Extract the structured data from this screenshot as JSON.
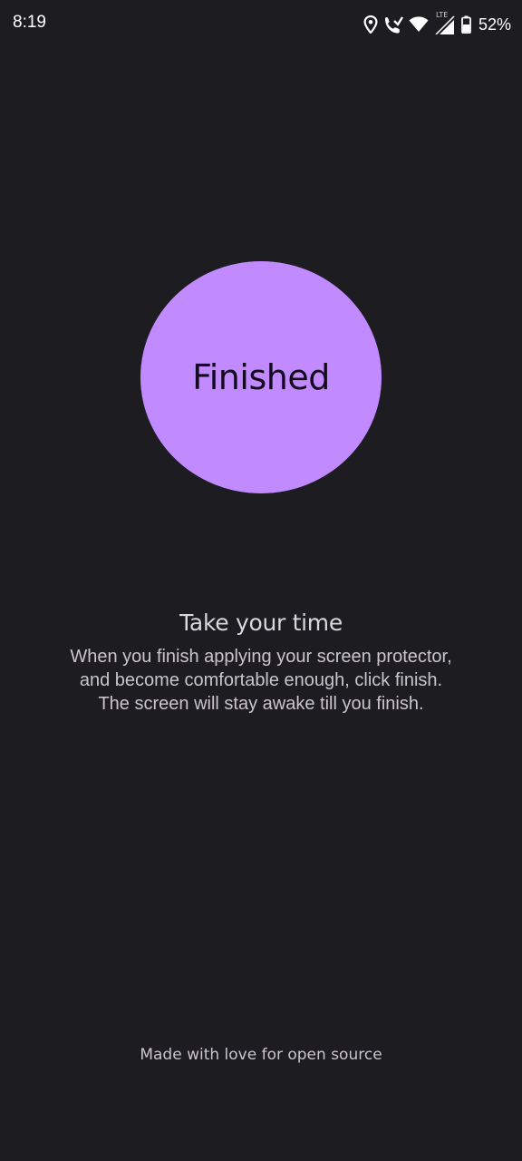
{
  "status_bar": {
    "time": "8:19",
    "network_label": "LTE",
    "battery": "52%",
    "icons": [
      "location-icon",
      "wifi-call-icon",
      "wifi-icon",
      "signal-icon",
      "battery-icon"
    ]
  },
  "main": {
    "finish_button_label": "Finished",
    "title": "Take your time",
    "body_lines": [
      "When you finish applying your screen protector,",
      "and become comfortable enough, click finish.",
      "The screen will stay awake till you finish."
    ]
  },
  "footer": {
    "text": "Made with love for open source"
  },
  "colors": {
    "background": "#1d1c21",
    "accent": "#c18bff",
    "text": "#cac5cd"
  }
}
